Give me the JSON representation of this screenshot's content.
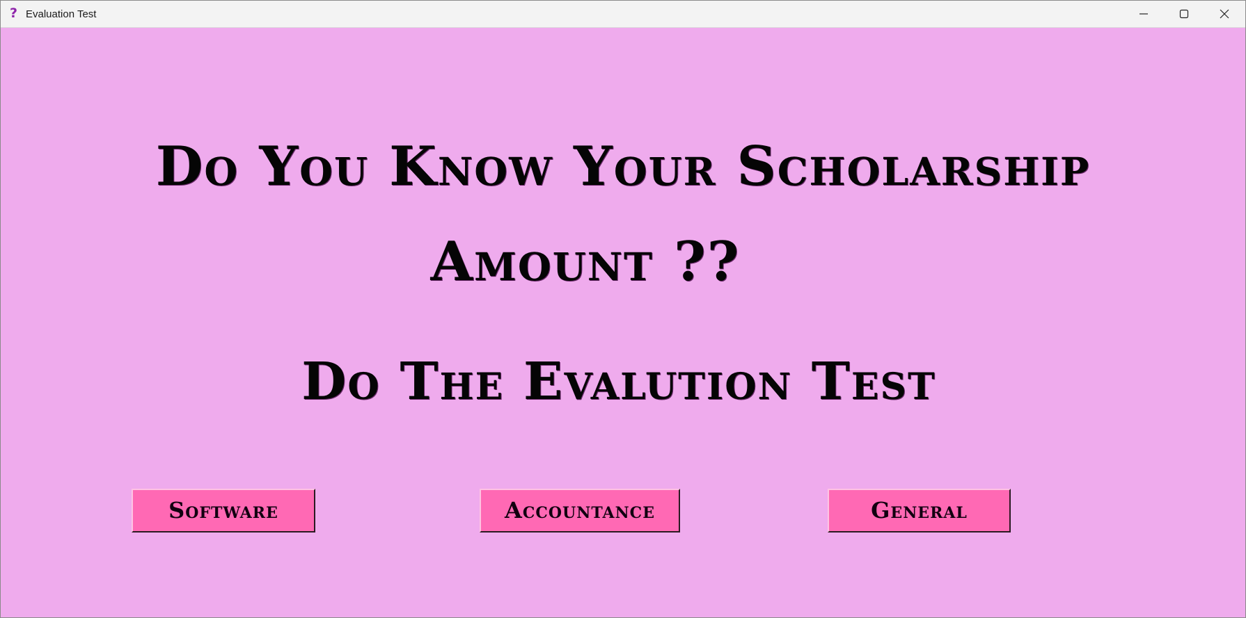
{
  "window": {
    "title": "Evaluation Test",
    "icon": "question-mark-icon",
    "controls": [
      "minimize-icon",
      "maximize-icon",
      "close-icon"
    ]
  },
  "main": {
    "headline_line1": "Do You Know Your Scholarship",
    "headline_line2": "Amount ??",
    "subheadline": "Do The Evalution Test"
  },
  "buttons": {
    "software": "Software",
    "accountance": "Accountance",
    "general": "General"
  },
  "colors": {
    "background": "#efabed",
    "button": "#ff69b4",
    "text": "#050505",
    "icon": "#8e24aa"
  }
}
